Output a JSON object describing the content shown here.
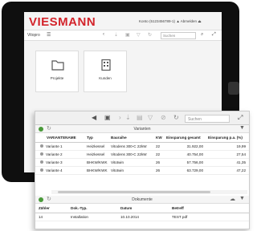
{
  "tablet": {
    "logo": "VIESMANN",
    "account_line": "Konto (5123456789-1)",
    "logout": "Abmelden",
    "app_menu": "Vitopro",
    "search_placeholder": "Suchen",
    "tiles": [
      {
        "label": "Projekte",
        "icon": "folder-icon"
      },
      {
        "label": "Kunden",
        "icon": "building-icon"
      }
    ]
  },
  "app": {
    "search_placeholder": "Suchen",
    "variants_title": "Varianten",
    "columns": [
      "VARIANTENAME",
      "Typ",
      "Bauraihe",
      "KW",
      "Einsparung gesamt",
      "Einsparung p.a. (%)"
    ],
    "rows": [
      [
        "Variante 1",
        "Heizkessel",
        "Vitodens 300-C 22kW",
        "22",
        "31.922,00",
        "19,99"
      ],
      [
        "Variante 2",
        "Heizkessel",
        "Vitodens 300-C 22kW",
        "22",
        "40.754,00",
        "27,54"
      ],
      [
        "Variante 3",
        "BHKW/KWK",
        "Vitotwin",
        "26",
        "57.756,00",
        "41,35"
      ],
      [
        "Variante 4",
        "BHKW/KWK",
        "Vitotwin",
        "26",
        "63.729,00",
        "47,22"
      ]
    ],
    "documents_title": "Dokumente",
    "doc_columns": [
      "Zähler",
      "Dok.-Typ.",
      "Datum",
      "Betreff"
    ],
    "doc_rows": [
      [
        "14",
        "Installation",
        "10.10.2014",
        "TEST pdf"
      ]
    ]
  },
  "colors": {
    "brand": "#d3242b",
    "ok": "#4a9a3a"
  }
}
